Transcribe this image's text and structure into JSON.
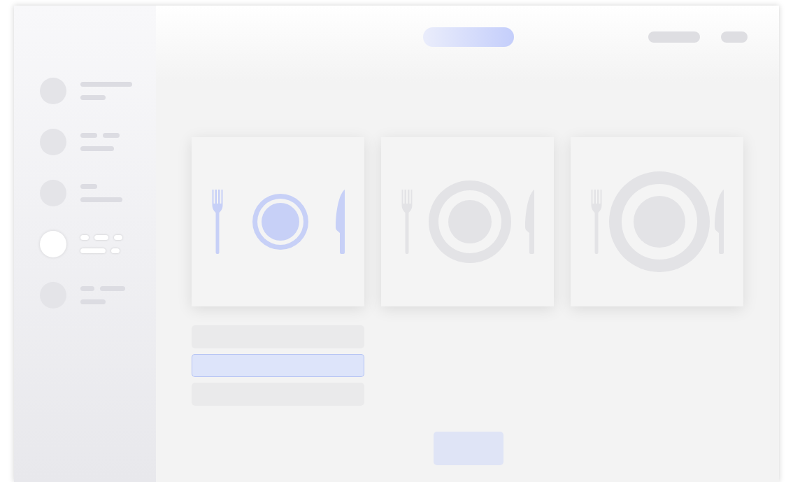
{
  "sidebar": {
    "items": [
      {
        "selected": false
      },
      {
        "selected": false
      },
      {
        "selected": false
      },
      {
        "selected": true
      },
      {
        "selected": false
      }
    ]
  },
  "cards": [
    {
      "kind": "small",
      "selected": true
    },
    {
      "kind": "medium",
      "selected": false
    },
    {
      "kind": "large",
      "selected": false
    }
  ],
  "options": [
    {
      "selected": false
    },
    {
      "selected": true
    },
    {
      "selected": false
    }
  ]
}
